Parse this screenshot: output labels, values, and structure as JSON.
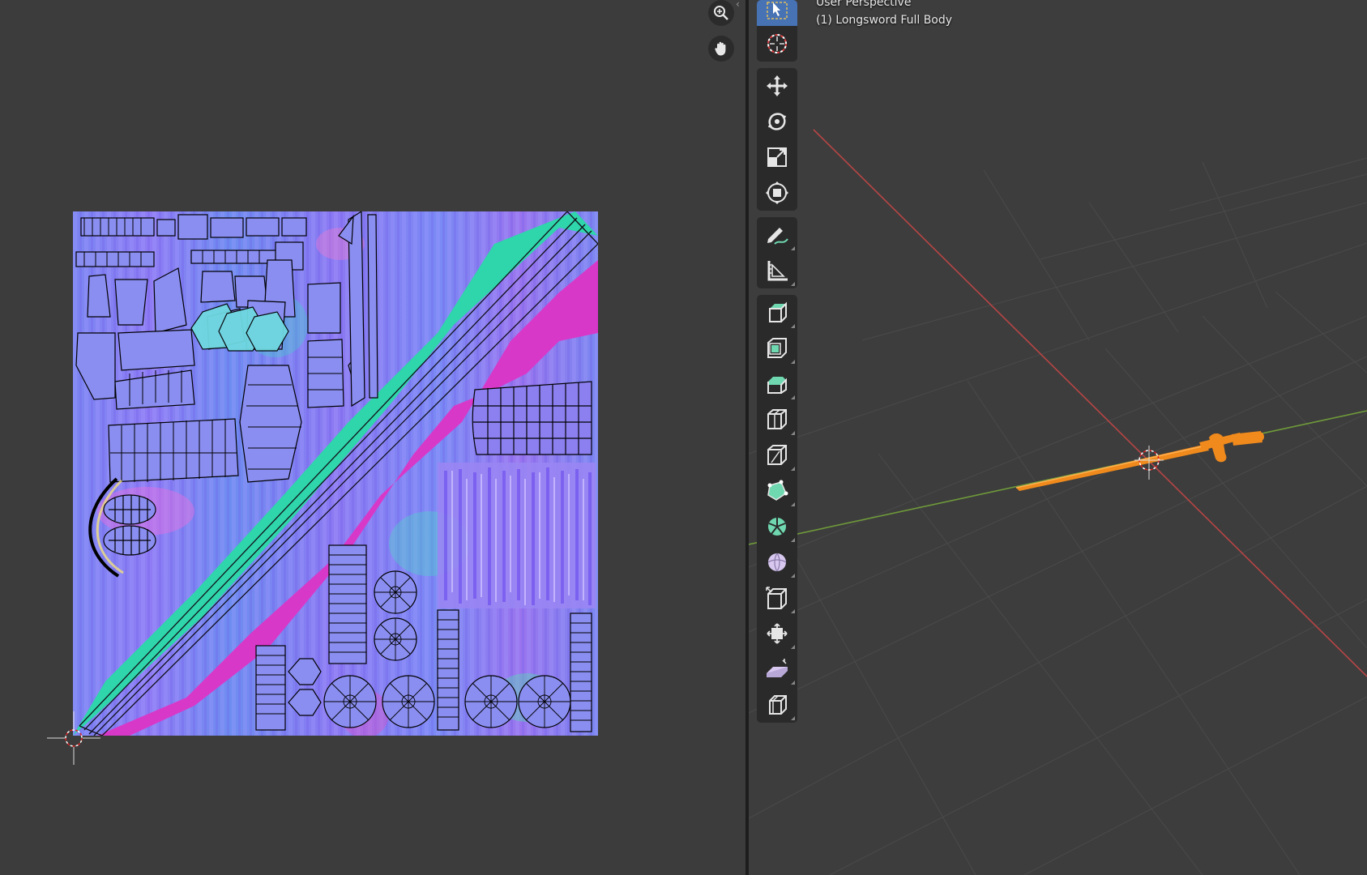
{
  "uv_editor": {
    "nav_buttons": [
      {
        "icon": "zoom-icon"
      },
      {
        "icon": "hand-pan-icon"
      }
    ],
    "collapse_icon": "chevron-left-icon"
  },
  "viewport": {
    "view_name": "User Perspective",
    "object_label": "(1) Longsword Full Body"
  },
  "toolbar": {
    "groups": [
      [
        "select-box-icon",
        "cursor-icon"
      ],
      [
        "move-icon",
        "rotate-icon",
        "scale-icon",
        "transform-icon"
      ],
      [
        "annotate-icon",
        "measure-icon"
      ],
      [
        "extrude-region-icon",
        "inset-faces-icon",
        "bevel-icon",
        "loop-cut-icon",
        "knife-icon",
        "poly-build-icon",
        "spin-icon",
        "smooth-icon",
        "edge-slide-icon",
        "shrink-fatten-icon",
        "shear-icon",
        "rip-region-icon"
      ]
    ]
  },
  "colors": {
    "background": "#3d3d3d",
    "active_tool": "#4772b3",
    "x_axis": "#b84545",
    "y_axis": "#6f9a3a",
    "selection": "#f08a1c",
    "uv_base": "#8a78f0",
    "uv_teal": "#2ed3a8",
    "uv_magenta": "#d83ac8"
  }
}
